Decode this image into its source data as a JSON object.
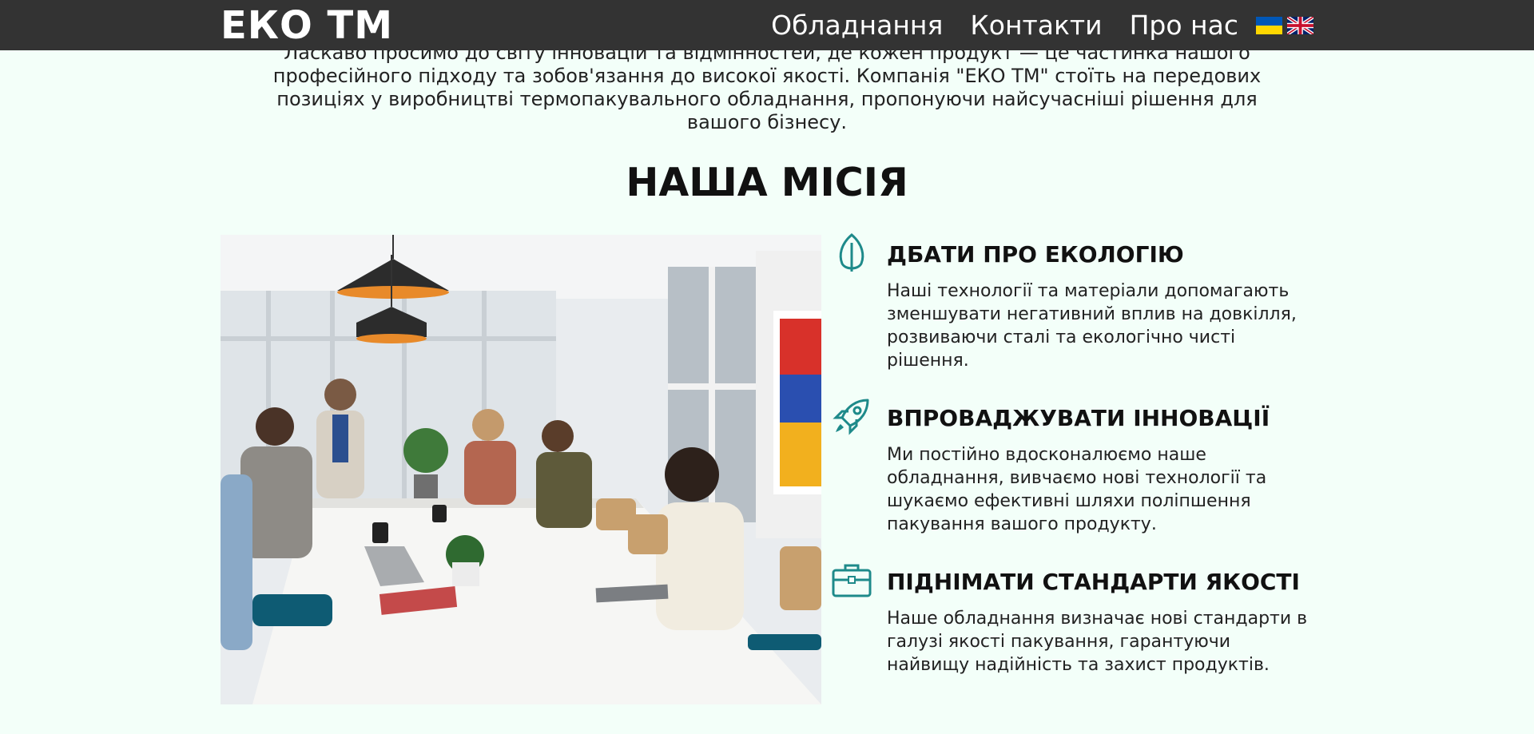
{
  "header": {
    "logo": "ЕКО ТМ",
    "nav": [
      "Обладнання",
      "Контакти",
      "Про нас"
    ],
    "languages": [
      "uk-flag-icon",
      "uk-union-jack-icon"
    ]
  },
  "intro": {
    "text": "Ласкаво просимо до світу інновацій та відмінностей, де кожен продукт — це частинка нашого професійного підходу та зобов'язання до високої якості. Компанія \"ЕКО ТМ\" стоїть на передових позиціях у виробництві термопакувального обладнання, пропонуючи найсучасніші рішення для вашого бізнесу."
  },
  "mission": {
    "title": "НАША МІСІЯ",
    "items": [
      {
        "icon": "leaf-icon",
        "title": "ДБАТИ ПРО ЕКОЛОГІЮ",
        "text": "Наші технології та матеріали допомагають зменшувати негативний вплив на довкілля, розвиваючи сталі та екологічно чисті рішення."
      },
      {
        "icon": "rocket-icon",
        "title": "ВПРОВАДЖУВАТИ ІННОВАЦІЇ",
        "text": "Ми постійно вдосконалюємо наше обладнання, вивчаємо нові технології та шукаємо ефективні шляхи поліпшення пакування вашого продукту."
      },
      {
        "icon": "briefcase-icon",
        "title": "ПІДНІМАТИ СТАНДАРТИ ЯКОСТІ",
        "text": "Наше обладнання визначає нові стандарти в галузі якості пакування, гарантуючи найвищу надійність та захист продуктів."
      }
    ]
  },
  "colors": {
    "header_bg": "#333333",
    "page_bg": "#f3fff9",
    "accent": "#1e8a8a"
  }
}
